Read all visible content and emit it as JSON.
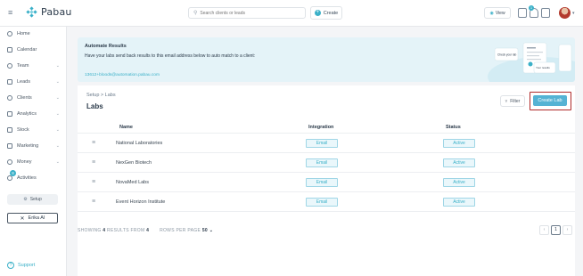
{
  "app": {
    "name": "Pabau"
  },
  "header": {
    "search_placeholder": "Search clients or leads",
    "create_label": "Create",
    "view_label": "View",
    "notification_count": "1"
  },
  "sidebar": {
    "items": [
      {
        "label": "Home",
        "icon": "home-icon",
        "has_caret": false
      },
      {
        "label": "Calendar",
        "icon": "calendar-icon",
        "has_caret": false
      },
      {
        "label": "Team",
        "icon": "team-icon",
        "has_caret": true
      },
      {
        "label": "Leads",
        "icon": "leads-icon",
        "has_caret": true
      },
      {
        "label": "Clients",
        "icon": "clients-icon",
        "has_caret": true
      },
      {
        "label": "Analytics",
        "icon": "analytics-icon",
        "has_caret": true
      },
      {
        "label": "Stock",
        "icon": "stock-icon",
        "has_caret": true
      },
      {
        "label": "Marketing",
        "icon": "marketing-icon",
        "has_caret": true
      },
      {
        "label": "Money",
        "icon": "money-icon",
        "has_caret": true
      },
      {
        "label": "Activities",
        "icon": "activities-icon",
        "has_caret": false
      }
    ],
    "activities_badge": "8",
    "setup_label": "Setup",
    "erika_label": "Erika AI",
    "support_label": "Support"
  },
  "banner": {
    "title": "Automate Results",
    "text": "Have your labs send back results to this email address below to auto match to a client:",
    "email": "13612+bloods@automation.pabau.com",
    "art_labels": [
      "Check your lab",
      "Your results"
    ]
  },
  "page": {
    "breadcrumb": [
      "Setup",
      "Labs"
    ],
    "title": "Labs",
    "filter_label": "Filter",
    "create_lab_label": "Create Lab"
  },
  "table": {
    "columns": [
      "Name",
      "Integration",
      "Status"
    ],
    "rows": [
      {
        "name": "National Laboratories",
        "integration": "Email",
        "status": "Active"
      },
      {
        "name": "NexGen Biotech",
        "integration": "Email",
        "status": "Active"
      },
      {
        "name": "NovaMed Labs",
        "integration": "Email",
        "status": "Active"
      },
      {
        "name": "Event Horizon Institute",
        "integration": "Email",
        "status": "Active"
      }
    ]
  },
  "footer": {
    "showing_prefix": "SHOWING",
    "showing_count": "4",
    "results_from": "RESULTS FROM",
    "total": "4",
    "rows_per_page_label": "ROWS PER PAGE",
    "rows_per_page_value": "50",
    "current_page": "1"
  },
  "colors": {
    "accent": "#3ab0c8",
    "create_lab_bg": "#55b3d4",
    "highlight_border": "#b02a2a",
    "banner_bg": "#e4f3f8"
  }
}
